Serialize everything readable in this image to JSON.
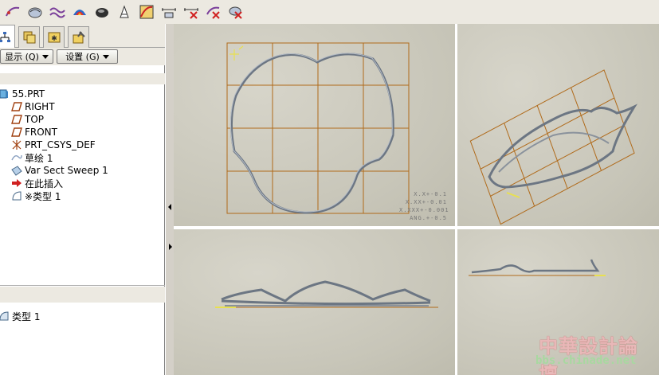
{
  "toolbar": {
    "icons": [
      "datum-curve-icon",
      "fillet-surface-icon",
      "wave-curve-icon",
      "color-sphere-icon",
      "shaded-surface-icon",
      "text-edit-icon",
      "graph-curve-icon",
      "dimension-icon",
      "dimension-delete-icon",
      "curve-delete-icon",
      "surface-delete-icon"
    ]
  },
  "tabs": [
    "model-tree",
    "layers",
    "feature-folder",
    "tools"
  ],
  "menus": {
    "show_label": "显示 (Q)",
    "settings_label": "设置 (G)"
  },
  "tree": {
    "items": [
      {
        "label": "55.PRT",
        "icon": "part-icon"
      },
      {
        "label": "RIGHT",
        "icon": "datum-plane-icon"
      },
      {
        "label": "TOP",
        "icon": "datum-plane-icon"
      },
      {
        "label": "FRONT",
        "icon": "datum-plane-icon"
      },
      {
        "label": "PRT_CSYS_DEF",
        "icon": "csys-icon"
      },
      {
        "label": "草绘 1",
        "icon": "sketch-icon"
      },
      {
        "label": "Var Sect Sweep 1",
        "icon": "sweep-icon"
      },
      {
        "label": "在此插入",
        "icon": "insert-arrow-icon"
      },
      {
        "label": "※类型 1",
        "icon": "type-surface-icon"
      }
    ]
  },
  "detail_tree": {
    "items": [
      {
        "label": "类型 1",
        "icon": "type-surface-icon"
      }
    ]
  },
  "viewport": {
    "datum_mark": "T",
    "dim_lines": [
      "X.X+-0.1",
      "X.XX+-0.01",
      "X.XXX+-0.001",
      "ANG.+-0.5"
    ]
  },
  "watermark": {
    "title": "中華設計論壇",
    "url": "bbs.chinade.net"
  },
  "colors": {
    "grid": "#b06a1a",
    "curve": "#7f8a98",
    "datum_yellow": "#e8e050",
    "watermark_red": "#c03838",
    "watermark_green": "#7fb070"
  }
}
